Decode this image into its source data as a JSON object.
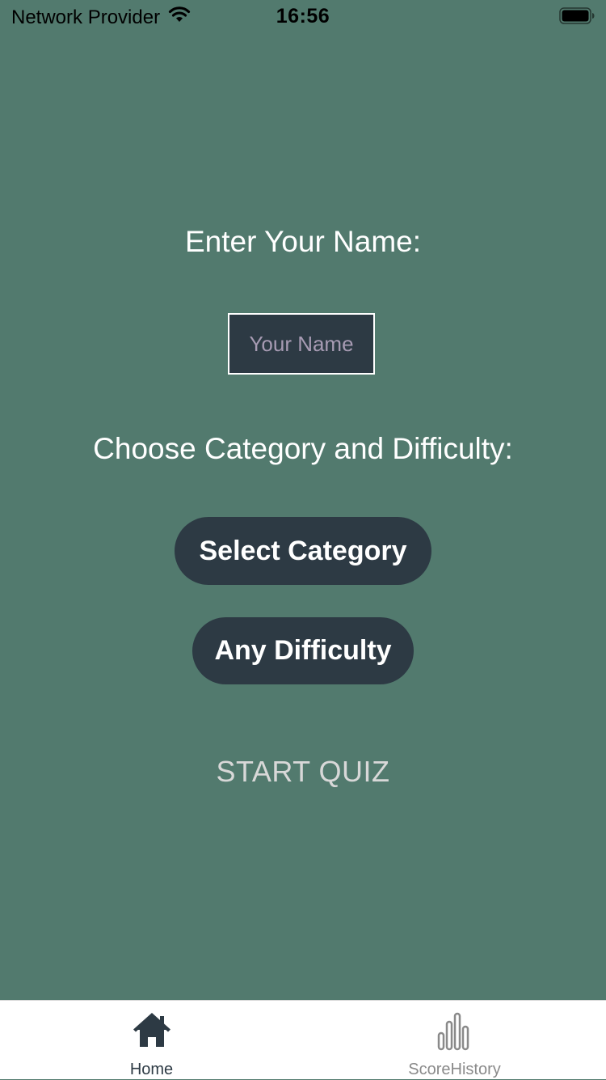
{
  "status_bar": {
    "carrier": "Network Provider",
    "time": "16:56",
    "wifi_icon": "wifi-icon",
    "battery_icon": "battery-icon"
  },
  "main": {
    "name_prompt": "Enter Your Name:",
    "name_input": {
      "placeholder": "Your Name",
      "value": ""
    },
    "choose_prompt": "Choose Category and Difficulty:",
    "category_button": "Select Category",
    "difficulty_button": "Any Difficulty",
    "start_button": "START QUIZ"
  },
  "tab_bar": {
    "tabs": [
      {
        "label": "Home",
        "icon": "home-icon",
        "active": true
      },
      {
        "label": "ScoreHistory",
        "icon": "bar-chart-icon",
        "active": false
      }
    ]
  },
  "colors": {
    "background": "#527a6e",
    "button": "#2d3a44",
    "active_tab": "#2d3a44",
    "inactive_tab": "#8a8a8a"
  }
}
